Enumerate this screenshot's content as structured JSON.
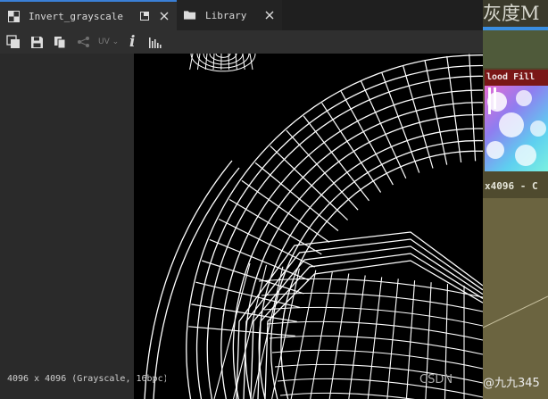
{
  "tabs": [
    {
      "label": "Invert_grayscale",
      "icon": "image-grid-icon",
      "active": true
    },
    {
      "label": "Library",
      "icon": "folder-icon",
      "active": false
    }
  ],
  "toolbar": {
    "uv_label": "UV",
    "info_label": "i"
  },
  "status": {
    "text": "4096 x 4096 (Grayscale, 16bpc)"
  },
  "side_panel": {
    "title": "灰度M",
    "flood_label": "lood Fill",
    "dims_text": "x4096 - C"
  },
  "watermark": {
    "left": "CSDN",
    "right": "@九九345"
  },
  "colors": {
    "accent": "#3a7fd6",
    "viewport_bg": "#000000",
    "wire": "#ffffff",
    "flood_header": "#7a1717"
  }
}
